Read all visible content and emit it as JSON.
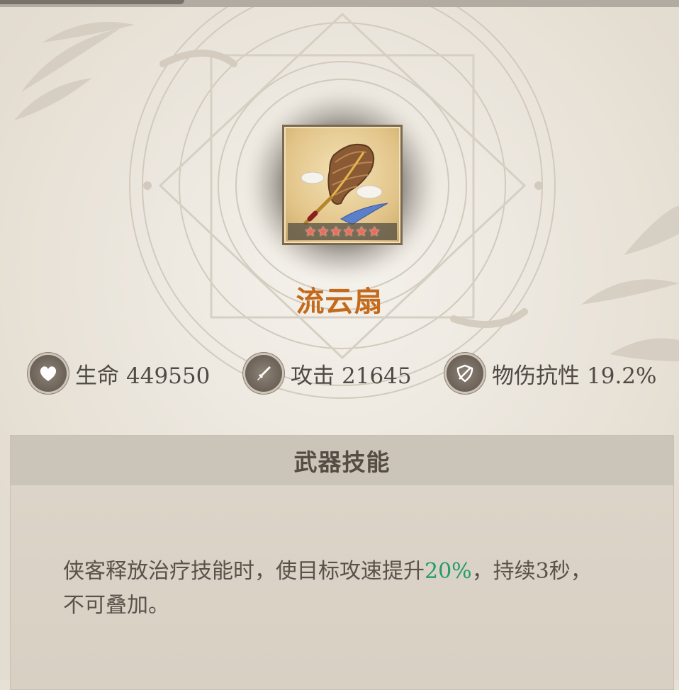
{
  "item": {
    "name": "流云扇",
    "rarity_stars": 6,
    "star_glyph": "★",
    "icon": "folding-fan-weapon-icon",
    "name_color": "#c46a1c"
  },
  "stats": [
    {
      "icon": "heart-icon",
      "label": "生命",
      "value": "449550"
    },
    {
      "icon": "dagger-icon",
      "label": "攻击",
      "value": "21645"
    },
    {
      "icon": "shield-slash-icon",
      "label": "物伤抗性",
      "value": "19.2%"
    }
  ],
  "skill": {
    "title": "武器技能",
    "desc_before": "侠客释放治疗技能时，使目标攻速提升",
    "desc_highlight": "20%",
    "desc_after": "，持续3秒，",
    "desc_line2": "不可叠加。",
    "highlight_color": "#239c6e"
  }
}
